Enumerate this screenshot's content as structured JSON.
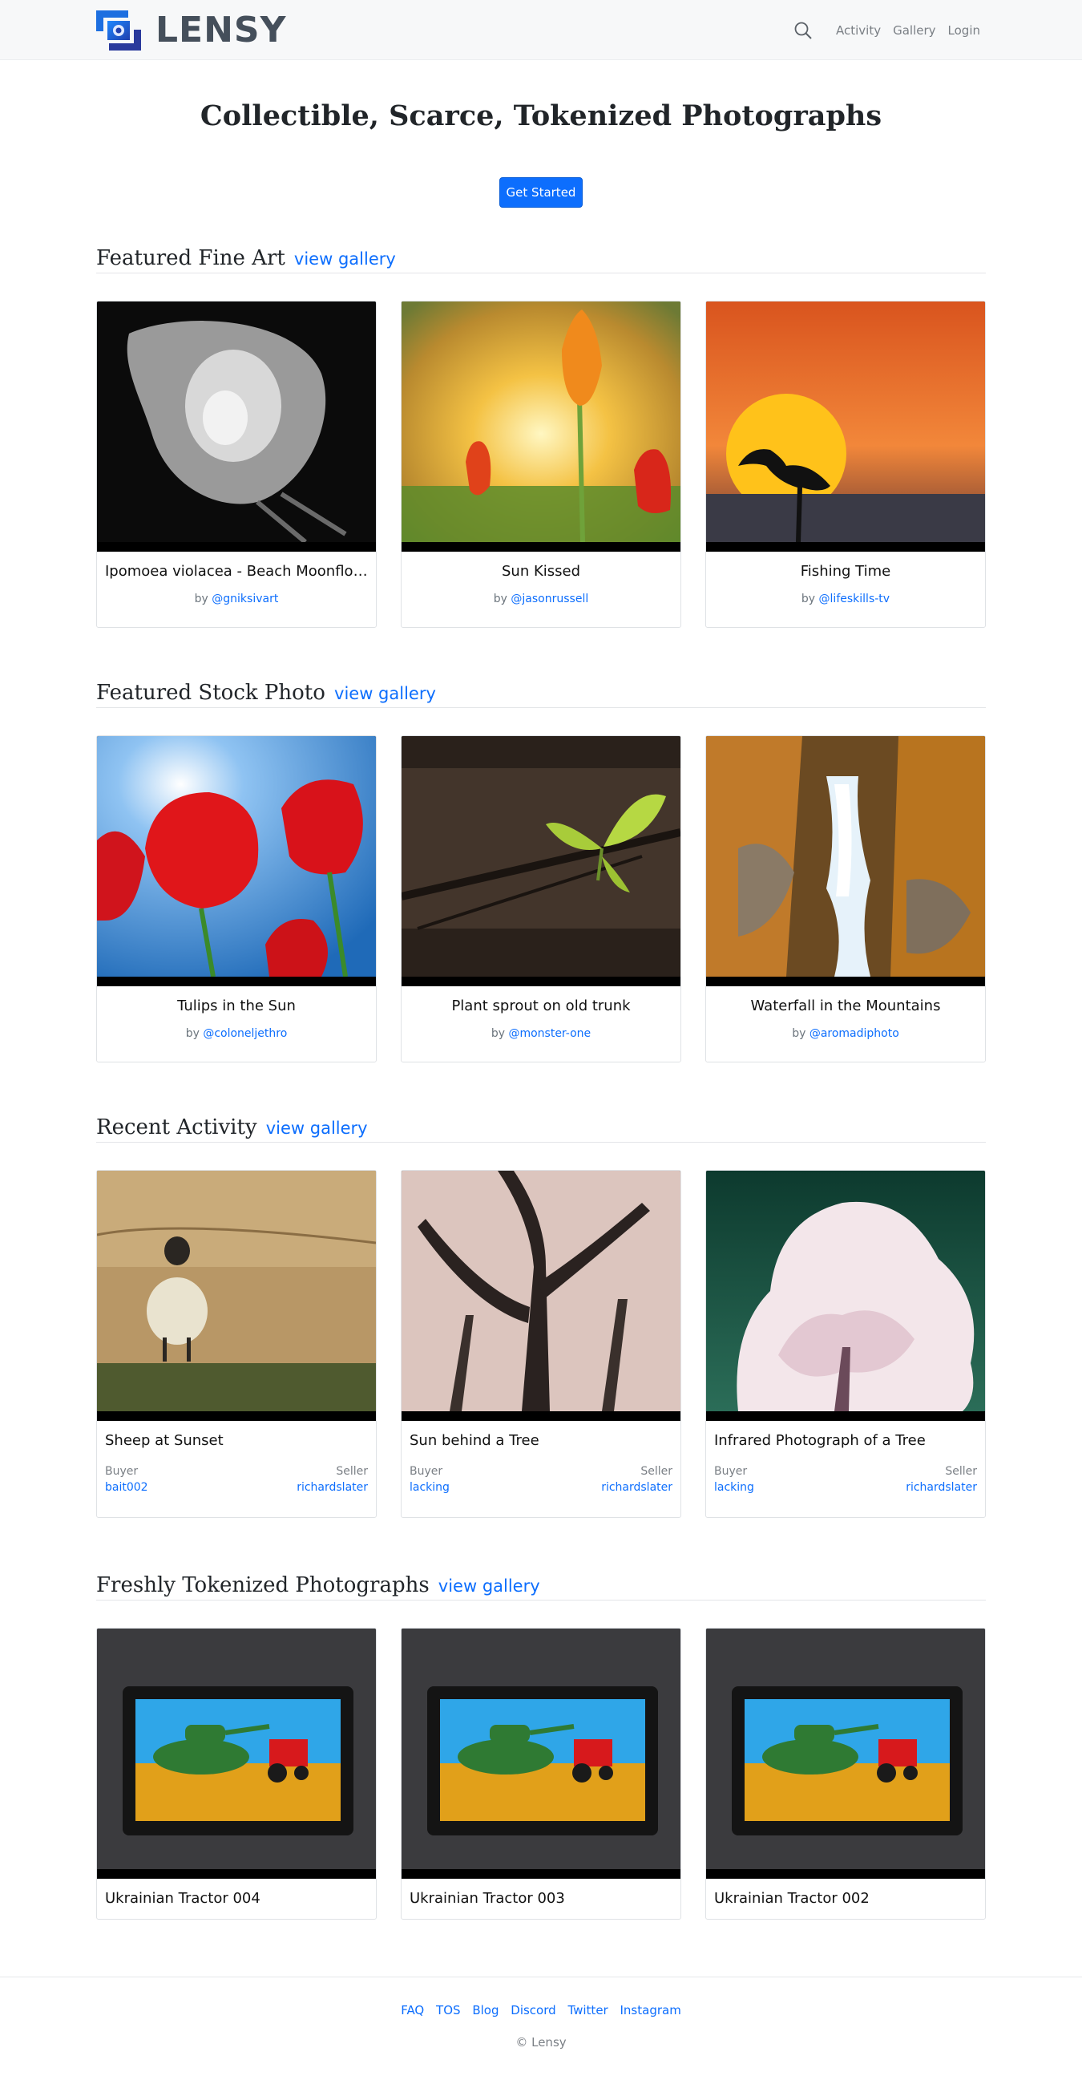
{
  "nav": {
    "brand": "LENSY",
    "links": [
      "Activity",
      "Gallery",
      "Login"
    ]
  },
  "hero": {
    "title": "Collectible, Scarce, Tokenized Photographs",
    "cta": "Get Started"
  },
  "sections": [
    {
      "title": "Featured Fine Art",
      "link": "view gallery",
      "cards": [
        {
          "title": "Ipomoea violacea - Beach Moonflower",
          "by": "by",
          "author": "@gniksivart"
        },
        {
          "title": "Sun Kissed",
          "by": "by",
          "author": "@jasonrussell"
        },
        {
          "title": "Fishing Time",
          "by": "by",
          "author": "@lifeskills-tv"
        }
      ]
    },
    {
      "title": "Featured Stock Photo",
      "link": "view gallery",
      "cards": [
        {
          "title": "Tulips in the Sun",
          "by": "by",
          "author": "@coloneljethro"
        },
        {
          "title": "Plant sprout on old trunk",
          "by": "by",
          "author": "@monster-one"
        },
        {
          "title": "Waterfall in the Mountains",
          "by": "by",
          "author": "@aromadiphoto"
        }
      ]
    },
    {
      "title": "Recent Activity",
      "link": "view gallery",
      "cards": [
        {
          "title": "Sheep at Sunset",
          "buyer_label": "Buyer",
          "seller_label": "Seller",
          "buyer": "bait002",
          "seller": "richardslater"
        },
        {
          "title": "Sun behind a Tree",
          "buyer_label": "Buyer",
          "seller_label": "Seller",
          "buyer": "lacking",
          "seller": "richardslater"
        },
        {
          "title": "Infrared Photograph of a Tree",
          "buyer_label": "Buyer",
          "seller_label": "Seller",
          "buyer": "lacking",
          "seller": "richardslater"
        }
      ]
    },
    {
      "title": "Freshly Tokenized Photographs",
      "link": "view gallery",
      "cards": [
        {
          "title": "Ukrainian Tractor 004"
        },
        {
          "title": "Ukrainian Tractor 003"
        },
        {
          "title": "Ukrainian Tractor 002"
        }
      ]
    }
  ],
  "footer": {
    "links": [
      "FAQ",
      "TOS",
      "Blog",
      "Discord",
      "Twitter",
      "Instagram"
    ],
    "copyright": "© Lensy"
  },
  "colors": {
    "accent": "#0d6efd",
    "navbar_bg": "#f7f8f9",
    "brand_text": "#454f5b"
  },
  "icons": [
    "lensy-logo-icon",
    "search-icon"
  ]
}
